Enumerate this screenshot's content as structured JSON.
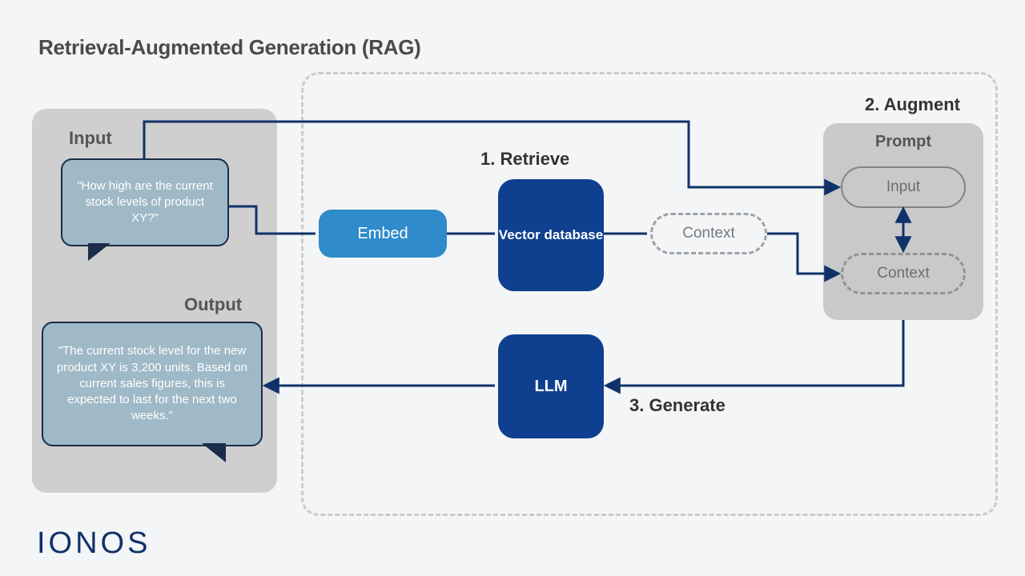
{
  "title": "Retrieval-Augmented Generation (RAG)",
  "io": {
    "input_label": "Input",
    "output_label": "Output",
    "input_text": "\"How high are the current stock levels of product XY?\"",
    "output_text": "\"The current stock level for the new product XY is 3,200 units. Based on current sales figures, this is expected to last for the next two weeks.\""
  },
  "steps": {
    "retrieve": "1. Retrieve",
    "augment": "2. Augment",
    "generate": "3. Generate"
  },
  "nodes": {
    "embed": "Embed",
    "vector_db": "Vector database",
    "context_retrieved": "Context",
    "llm": "LLM"
  },
  "prompt": {
    "title": "Prompt",
    "input": "Input",
    "context": "Context"
  },
  "brand": "IONOS",
  "colors": {
    "accent": "#0f3f8f",
    "accent_light": "#2f8bc9",
    "arrow": "#10326a"
  }
}
